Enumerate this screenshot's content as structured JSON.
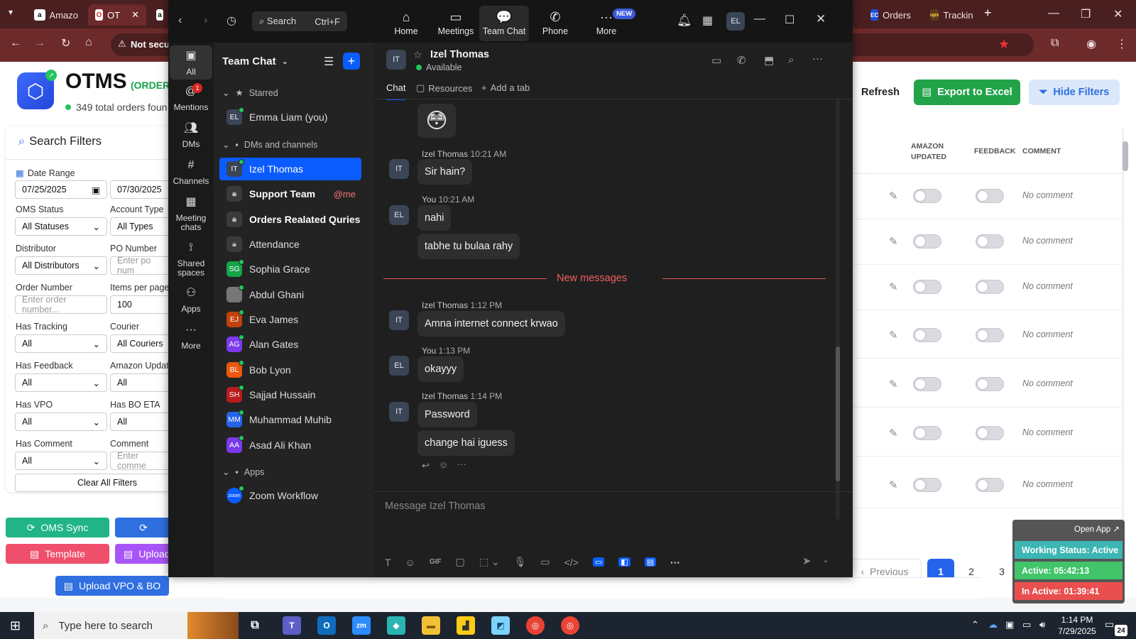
{
  "browser": {
    "tabs": [
      {
        "label": "Amazo",
        "icon": "a"
      },
      {
        "label": "OT",
        "icon": "O"
      },
      {
        "label": "",
        "icon": "a"
      },
      {
        "label": "Orders",
        "icon": "EC"
      },
      {
        "label": "Trackin",
        "icon": "ups"
      }
    ],
    "security_label": "Not secur"
  },
  "otms": {
    "title": "OTMS",
    "title_suffix": "(ORDER",
    "total_orders": "349 total orders foun",
    "refresh": "Refresh",
    "export": "Export to Excel",
    "hide_filters": "Hide Filters",
    "search_filters": "Search Filters",
    "date_range_label": "Date Range",
    "date_from": "07/25/2025",
    "date_to": "07/30/2025",
    "filters": {
      "oms_status_label": "OMS Status",
      "oms_status": "All Statuses",
      "account_type_label": "Account Type",
      "account_type": "All Types",
      "distributor_label": "Distributor",
      "distributor": "All Distributors",
      "po_number_label": "PO Number",
      "po_number_ph": "Enter po num",
      "order_number_label": "Order Number",
      "order_number_ph": "Enter order number...",
      "items_per_page_label": "Items per page",
      "items_per_page": "100",
      "has_tracking_label": "Has Tracking",
      "has_tracking": "All",
      "courier_label": "Courier",
      "courier": "All Couriers",
      "has_feedback_label": "Has Feedback",
      "has_feedback": "All",
      "amazon_updated_label": "Amazon Updat",
      "amazon_updated": "All",
      "has_vpo_label": "Has VPO",
      "has_vpo": "All",
      "has_bo_eta_label": "Has BO ETA",
      "has_bo_eta": "All",
      "has_comment_label": "Has Comment",
      "has_comment": "All",
      "comment_label": "Comment",
      "comment_ph": "Enter comme"
    },
    "clear_filters": "Clear All Filters",
    "oms_sync": "OMS Sync",
    "template": "Template",
    "upload": "Upload",
    "upload_vpo": "Upload VPO & BO",
    "columns": {
      "amazon_updated_1": "AMAZON",
      "amazon_updated_2": "UPDATED",
      "feedback": "FEEDBACK",
      "comment": "COMMENT"
    },
    "row_comments": [
      "No comment",
      "No comment",
      "No comment",
      "No comment",
      "No comment",
      "No comment",
      "No comment"
    ],
    "pagination": {
      "previous": "Previous",
      "pages": [
        "1",
        "2",
        "3"
      ]
    }
  },
  "zoom": {
    "search_label": "Search",
    "search_shortcut": "Ctrl+F",
    "nav": [
      {
        "label": "Home",
        "icon": "home-icon"
      },
      {
        "label": "Meetings",
        "icon": "video-icon"
      },
      {
        "label": "Team Chat",
        "icon": "chat-icon"
      },
      {
        "label": "Phone",
        "icon": "phone-icon"
      },
      {
        "label": "More",
        "icon": "more-icon"
      }
    ],
    "new_badge": "NEW",
    "me_initials": "EL",
    "rail": [
      {
        "label": "All",
        "icon": "chat-bubble-icon"
      },
      {
        "label": "Mentions",
        "icon": "at-icon",
        "badge": "1"
      },
      {
        "label": "DMs",
        "icon": "people-icon"
      },
      {
        "label": "Channels",
        "icon": "hash-icon"
      },
      {
        "label": "Meeting chats",
        "icon": "calendar-icon"
      },
      {
        "label": "Shared spaces",
        "icon": "share-icon"
      },
      {
        "label": "Apps",
        "icon": "apps-icon"
      },
      {
        "label": "More",
        "icon": "ellipsis-icon"
      }
    ],
    "list_title": "Team Chat",
    "starred_header": "Starred",
    "dms_header": "DMs and channels",
    "apps_header": "Apps",
    "starred": [
      {
        "initials": "EL",
        "name": "Emma Liam (you)",
        "color": "#3a4556"
      }
    ],
    "contacts": [
      {
        "initials": "IT",
        "name": "Izel Thomas",
        "color": "#3a4556"
      },
      {
        "initials": "",
        "name": "Support Team",
        "mention": "@me",
        "color": "#3a3a3a"
      },
      {
        "initials": "",
        "name": "Orders Realated Quries",
        "color": "#3a3a3a"
      },
      {
        "initials": "",
        "name": "Attendance",
        "color": "#3a3a3a"
      },
      {
        "initials": "SG",
        "name": "Sophia Grace",
        "color": "#16a34a"
      },
      {
        "initials": "",
        "name": "Abdul Ghani",
        "color": "#777777"
      },
      {
        "initials": "EJ",
        "name": "Eva James",
        "color": "#c2410c"
      },
      {
        "initials": "AG",
        "name": "Alan Gates",
        "color": "#7c3aed"
      },
      {
        "initials": "BL",
        "name": "Bob Lyon",
        "color": "#ea580c"
      },
      {
        "initials": "SH",
        "name": "Sajjad Hussain",
        "color": "#b91c1c"
      },
      {
        "initials": "MM",
        "name": "Muhammad Muhib",
        "color": "#2563eb"
      },
      {
        "initials": "AA",
        "name": "Asad Ali Khan",
        "color": "#7c3aed"
      }
    ],
    "apps": [
      {
        "initials": "zoom",
        "name": "Zoom Workflow",
        "color": "#0b5cff"
      }
    ],
    "chat": {
      "contact_initials": "IT",
      "contact_name": "Izel Thomas",
      "status": "Available",
      "tabs": [
        "Chat",
        "Resources",
        "Add a tab"
      ],
      "emoji": "😳",
      "new_messages": "New messages",
      "composer_placeholder": "Message Izel Thomas",
      "messages": [
        {
          "sender": "Izel Thomas",
          "time": "10:21 AM",
          "initials": "IT",
          "lines": [
            "Sir hain?"
          ]
        },
        {
          "sender": "You",
          "time": "10:21 AM",
          "initials": "EL",
          "lines": [
            "nahi",
            "tabhe tu bulaa rahy"
          ]
        },
        {
          "sender": "Izel Thomas",
          "time": "1:12 PM",
          "initials": "IT",
          "lines": [
            "Amna internet connect krwao"
          ]
        },
        {
          "sender": "You",
          "time": "1:13 PM",
          "initials": "EL",
          "lines": [
            "okayyy"
          ]
        },
        {
          "sender": "Izel Thomas",
          "time": "1:14 PM",
          "initials": "IT",
          "lines": [
            "Password",
            "change hai iguess"
          ]
        }
      ]
    }
  },
  "widget": {
    "open_app": "Open App ↗",
    "working_status": "Working Status: Active",
    "active": "Active: 05:42:13",
    "inactive": "In Active: 01:39:41"
  },
  "taskbar": {
    "search_placeholder": "Type here to search",
    "time": "1:14 PM",
    "date": "7/29/2025",
    "notifications": "24"
  }
}
